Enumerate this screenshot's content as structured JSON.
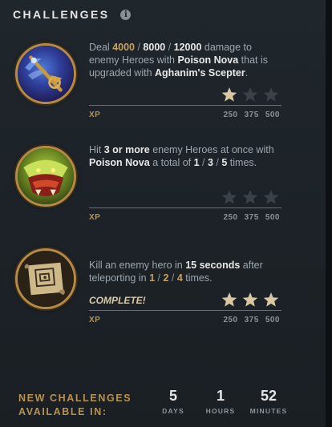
{
  "header": {
    "title": "CHALLENGES",
    "info_icon": "i"
  },
  "challenges": [
    {
      "icon": "poison-nova-scepter-icon",
      "text": [
        "Deal ",
        "4000",
        " / ",
        "8000",
        " / ",
        "12000",
        " damage to enemy Heroes with ",
        "Poison Nova",
        " that is upgraded with ",
        "Aghanim's Scepter",
        "."
      ],
      "complete_text": "",
      "stars_earned": 1,
      "stars_total": 3,
      "xp_label": "XP",
      "xp_values": [
        "250",
        "375",
        "500"
      ]
    },
    {
      "icon": "venomancer-head-icon",
      "text": [
        "Hit ",
        "3 or more",
        " enemy Heroes at once with ",
        "Poison Nova",
        " a total of ",
        "1",
        " / ",
        "3",
        " / ",
        "5",
        " times."
      ],
      "complete_text": "",
      "stars_earned": 0,
      "stars_total": 3,
      "xp_label": "XP",
      "xp_values": [
        "250",
        "375",
        "500"
      ]
    },
    {
      "icon": "teleport-scroll-icon",
      "text": [
        "Kill an enemy hero in ",
        "15 seconds",
        " after teleporting in ",
        "1",
        " / ",
        "2",
        " / ",
        "4",
        " times."
      ],
      "complete_text": "COMPLETE!",
      "stars_earned": 3,
      "stars_total": 3,
      "xp_label": "XP",
      "xp_values": [
        "250",
        "375",
        "500"
      ]
    }
  ],
  "footer": {
    "label_line1": "NEW CHALLENGES",
    "label_line2": "AVAILABLE IN:",
    "timers": [
      {
        "value": "5",
        "unit": "DAYS"
      },
      {
        "value": "1",
        "unit": "HOURS"
      },
      {
        "value": "52",
        "unit": "MINUTES"
      }
    ]
  },
  "colors": {
    "gold": "#c9a064",
    "star_filled": "#d8c7a3",
    "star_empty": "#3a4148",
    "xp_gold": "#b8914f"
  }
}
